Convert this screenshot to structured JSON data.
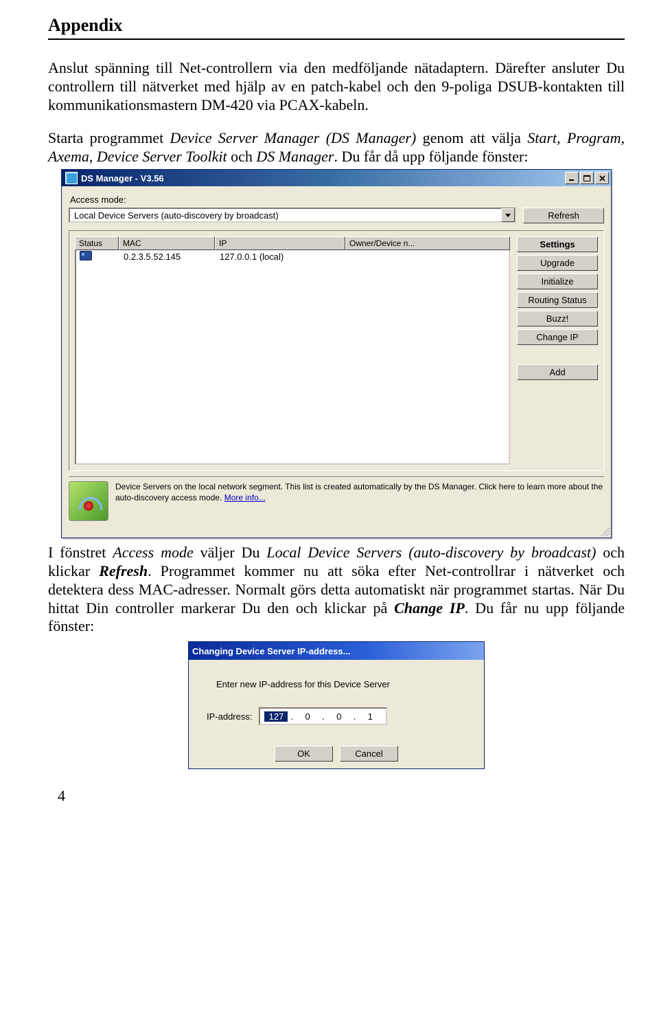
{
  "doc": {
    "appendix_heading": "Appendix",
    "p1": "Anslut spänning till Net-controllern via den medföljande nätadaptern. Därefter ansluter Du controllern till nätverket med hjälp av en patch-kabel och den 9-poliga DSUB-kontakten till kommunikationsmastern DM-420 via PCAX-kabeln.",
    "p2_a": "Starta programmet ",
    "p2_i1": "Device Server Manager (DS Manager)",
    "p2_b": " genom att välja ",
    "p2_i2": "Start, Program, Axema, Device Server Toolkit",
    "p2_c": " och ",
    "p2_i3": "DS Manager",
    "p2_d": ". Du får då upp följande fönster:",
    "p3_a": "I fönstret ",
    "p3_i1": "Access mode",
    "p3_b": " väljer Du ",
    "p3_i2": "Local Device Servers (auto-discovery by broadcast)",
    "p3_c": " och klickar ",
    "p3_bi1": "Refresh",
    "p3_d": ". Programmet kommer nu att söka efter Net-controllrar i nätverket och detektera dess MAC-adresser. Normalt görs detta automatiskt när programmet startas. När Du hittat Din controller markerar Du den och klickar på ",
    "p3_bi2": "Change IP",
    "p3_e": ". Du får nu upp följande fönster:",
    "page_number": "4"
  },
  "dsmanager": {
    "title": "DS Manager - V3.56",
    "access_mode_label": "Access mode:",
    "combo_value": "Local Device Servers (auto-discovery by broadcast)",
    "btn_refresh": "Refresh",
    "cols": {
      "status": "Status",
      "mac": "MAC",
      "ip": "IP",
      "owner": "Owner/Device n..."
    },
    "row": {
      "mac": "0.2.3.5.52.145",
      "ip": "127.0.0.1 (local)",
      "owner": ""
    },
    "side": {
      "settings": "Settings",
      "upgrade": "Upgrade",
      "initialize": "Initialize",
      "routing": "Routing Status",
      "buzz": "Buzz!",
      "changeip": "Change IP",
      "add": "Add"
    },
    "info_text": "Device Servers on the local network segment. This list is created automatically by the DS Manager. Click here to learn more about the auto-discovery access mode. ",
    "info_link": "More info..."
  },
  "changeip": {
    "title": "Changing Device Server IP-address...",
    "msg": "Enter new IP-address for this Device Server",
    "label": "IP-address:",
    "octets": [
      "127",
      "0",
      "0",
      "1"
    ],
    "ok": "OK",
    "cancel": "Cancel"
  }
}
